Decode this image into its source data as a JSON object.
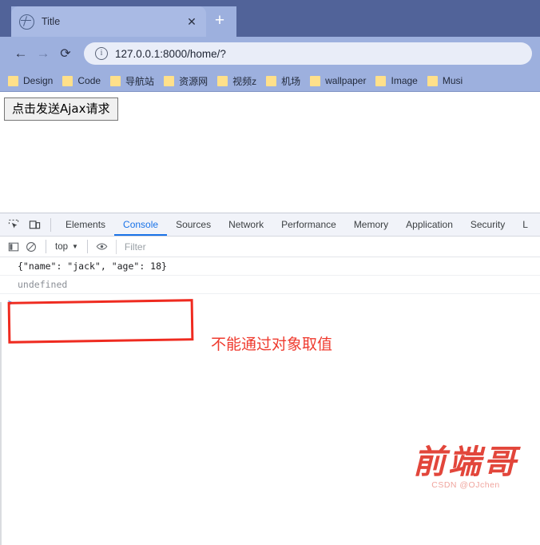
{
  "browser": {
    "tab": {
      "title": "Title",
      "favicon_icon": "globe-icon",
      "close_icon": "✕"
    },
    "new_tab_label": "+",
    "nav": {
      "back_icon": "←",
      "forward_icon": "→",
      "reload_icon": "⟳",
      "info_icon": "i",
      "url": "127.0.0.1:8000/home/?"
    },
    "bookmarks": [
      {
        "label": "Design"
      },
      {
        "label": "Code"
      },
      {
        "label": "导航站"
      },
      {
        "label": "资源网"
      },
      {
        "label": "视频z"
      },
      {
        "label": "机场"
      },
      {
        "label": "wallpaper"
      },
      {
        "label": "Image"
      },
      {
        "label": "Musi"
      }
    ]
  },
  "page": {
    "ajax_button_label": "点击发送Ajax请求"
  },
  "devtools": {
    "inspect_icon": "inspect-element-icon",
    "device_icon": "device-toolbar-icon",
    "tabs": [
      {
        "label": "Elements",
        "active": false
      },
      {
        "label": "Console",
        "active": true
      },
      {
        "label": "Sources",
        "active": false
      },
      {
        "label": "Network",
        "active": false
      },
      {
        "label": "Performance",
        "active": false
      },
      {
        "label": "Memory",
        "active": false
      },
      {
        "label": "Application",
        "active": false
      },
      {
        "label": "Security",
        "active": false
      },
      {
        "label": "L",
        "active": false
      }
    ],
    "filterbar": {
      "sidebar_icon": "sidebar-toggle-icon",
      "clear_icon": "clear-console-icon",
      "context": "top",
      "caret": "▼",
      "eye_icon": "eye-icon",
      "filter_placeholder": "Filter"
    },
    "console": {
      "rows": [
        {
          "text": "{\"name\": \"jack\", \"age\": 18}",
          "kind": "result"
        },
        {
          "text": "undefined",
          "kind": "undefined"
        }
      ],
      "prompt": ">"
    }
  },
  "annotation": {
    "text": "不能通过对象取值",
    "color": "#ef3b2f"
  },
  "watermark": {
    "main": "前端哥",
    "sub": "CSDN @OJchen"
  },
  "colors": {
    "chrome_frame": "#9db0de",
    "chrome_frame_dark": "#516399",
    "active_tab": "#a9bae4",
    "devtools_accent": "#1a73e8",
    "annotation_red": "#ef2b20"
  }
}
